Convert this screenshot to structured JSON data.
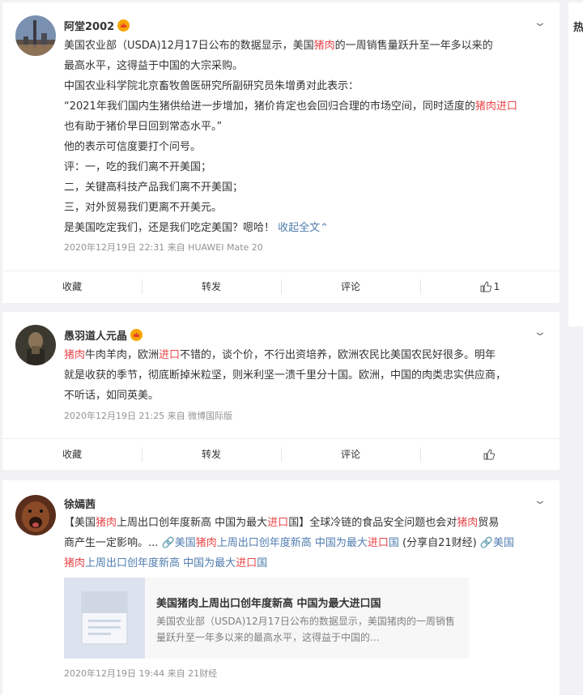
{
  "posts": [
    {
      "username": "阿堂2002",
      "lines": [
        [
          {
            "t": "美国农业部（USDA)12月17日公布的数据显示，美国"
          },
          {
            "t": "猪肉",
            "c": "hl"
          },
          {
            "t": "的一周销售量跃升至一年多以来的"
          }
        ],
        [
          {
            "t": "最高水平，这得益于中国的大宗采购。"
          }
        ],
        [
          {
            "t": "中国农业科学院北京畜牧兽医研究所副研究员朱增勇对此表示："
          }
        ],
        [
          {
            "t": "“2021年我们国内生猪供给进一步增加，猪价肯定也会回归合理的市场空间，同时适度的"
          },
          {
            "t": "猪肉进口",
            "c": "hl"
          }
        ],
        [
          {
            "t": "也有助于猪价早日回到常态水平。”"
          }
        ],
        [
          {
            "t": "他的表示可信度要打个问号。"
          }
        ],
        [
          {
            "t": "评：一，吃的我们离不开美国；"
          }
        ],
        [
          {
            "t": "二，关键高科技产品我们离不开美国；"
          }
        ],
        [
          {
            "t": "三，对外贸易我们更离不开美元。"
          }
        ],
        [
          {
            "t": "是美国吃定我们，还是我们吃定美国？嗯哈！ "
          },
          {
            "t": "收起全文",
            "c": "lnk"
          },
          {
            "t": "⌃",
            "c": "lnk"
          }
        ]
      ],
      "meta": "2020年12月19日 22:31  来自 HUAWEI Mate 20",
      "actions": {
        "fav": "收藏",
        "repost": "转发",
        "comment": "评论",
        "like": "1"
      }
    },
    {
      "username": "愚羽道人元晶",
      "lines": [
        [
          {
            "t": "猪肉",
            "c": "hl"
          },
          {
            "t": "牛肉羊肉，欧洲"
          },
          {
            "t": "进口",
            "c": "hl"
          },
          {
            "t": "不错的，谈个价，不行出资培养，欧洲农民比美国农民好很多。明年"
          }
        ],
        [
          {
            "t": "就是收获的季节，彻底断掉米粒坚，则米利坚一溃千里分十国。欧洲，中国的肉类忠实供应商，"
          }
        ],
        [
          {
            "t": "不听话，如同英美。"
          }
        ]
      ],
      "meta": "2020年12月19日 21:25  来自 微博国际版",
      "actions": {
        "fav": "收藏",
        "repost": "转发",
        "comment": "评论",
        "like": ""
      }
    },
    {
      "username": "徐嫣茜",
      "lines": [
        [
          {
            "t": "【美国"
          },
          {
            "t": "猪肉",
            "c": "hl"
          },
          {
            "t": "上周出口创年度新高 中国为最大"
          },
          {
            "t": "进口",
            "c": "hl"
          },
          {
            "t": "国】全球冷链的食品安全问题也会对"
          },
          {
            "t": "猪肉",
            "c": "hl"
          },
          {
            "t": "贸易"
          }
        ],
        [
          {
            "t": "商产生一定影响。... "
          },
          {
            "t": "🔗美国",
            "c": "lnk"
          },
          {
            "t": "猪肉",
            "c": "hl"
          },
          {
            "t": "上周出口创年度新高 中国为最大",
            "c": "lnk"
          },
          {
            "t": "进口",
            "c": "hl"
          },
          {
            "t": "国",
            "c": "lnk"
          },
          {
            "t": " (分享自21财经) "
          },
          {
            "t": "🔗美国",
            "c": "lnk"
          }
        ],
        [
          {
            "t": "猪肉",
            "c": "hl"
          },
          {
            "t": "上周出口创年度新高 中国为最大",
            "c": "lnk"
          },
          {
            "t": "进口",
            "c": "hl"
          },
          {
            "t": "国",
            "c": "lnk"
          }
        ]
      ],
      "preview": {
        "title": "美国猪肉上周出口创年度新高 中国为最大进口国",
        "desc": "美国农业部（USDA)12月17日公布的数据显示，美国猪肉的一周销售量跃升至一年多以来的最高水平，这得益于中国的..."
      },
      "meta": "2020年12月19日 19:44  来自 21财经"
    }
  ],
  "sidebar_glyph": "热"
}
